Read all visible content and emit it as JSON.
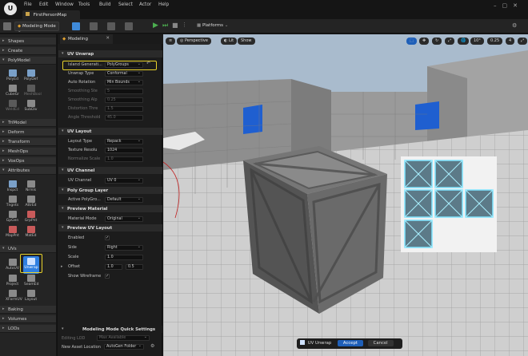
{
  "titlebar": {
    "map_name": "FirstPersonMap",
    "menus": [
      "File",
      "Edit",
      "Window",
      "Tools",
      "Build",
      "Select",
      "Actor",
      "Help"
    ]
  },
  "toolbar": {
    "mode_label": "Modeling Mode",
    "platforms_label": "Platforms"
  },
  "palette": {
    "categories": {
      "shapes": "Shapes",
      "create": "Create",
      "polymodel": "PolyModel",
      "trimodel": "TriModel",
      "deform": "Deform",
      "transform": "Transform",
      "meshops": "MeshOps",
      "voxops": "VoxOps",
      "attributes": "Attributes",
      "uvs": "UVs",
      "baking": "Baking",
      "volumes": "Volumes",
      "lods": "LODs"
    },
    "polymodel_tools": [
      "PolyEd",
      "PolyDef",
      "CubeGr",
      "MeshBool",
      "WeldEd",
      "SubDiv"
    ],
    "attribute_tools": [
      "Inspct",
      "Nrmls",
      "Tngnts",
      "AttrEd",
      "GpGen",
      "GrpPnt",
      "MapPnt",
      "MatEd"
    ],
    "uv_tools": [
      "AutoUV",
      "Unwrap",
      "Project",
      "SeamEd",
      "XFormUV",
      "Layout"
    ]
  },
  "panel": {
    "tab_label": "Modeling",
    "uv_unwrap": {
      "title": "UV Unwrap",
      "island_gen_label": "Island Generati...",
      "island_gen_value": "PolyGroups",
      "unwrap_type_label": "Unwrap Type",
      "unwrap_type_value": "Conformal",
      "auto_rotation_label": "Auto Rotation",
      "auto_rotation_value": "Min Bounds",
      "smoothing_label": "Smoothing Ste",
      "smoothing_value": "5",
      "smoothing_alpha_label": "Smoothing Alp",
      "smoothing_alpha_value": "0.25",
      "distortion_label": "Distortion Thre",
      "distortion_value": "1.5",
      "angle_label": "Angle Threshold",
      "angle_value": "45.0"
    },
    "uv_layout": {
      "title": "UV Layout",
      "layout_type_label": "Layout Type",
      "layout_type_value": "Repack",
      "texture_res_label": "Texture Resolu",
      "texture_res_value": "1024",
      "uniform_scale_label": "Normalize Scale",
      "uniform_scale_value": "1.0"
    },
    "uv_channel": {
      "title": "UV Channel",
      "label": "UV Channel",
      "value": "UV 0"
    },
    "poly_group_layer": {
      "title": "Poly Group Layer",
      "label": "Active PolyGro...",
      "value": "Default"
    },
    "preview_material": {
      "title": "Preview Material",
      "label": "Material Mode",
      "value": "Original"
    },
    "preview_uv_layout": {
      "title": "Preview UV Layout",
      "enabled_label": "Enabled",
      "side_label": "Side",
      "side_value": "Right",
      "scale_label": "Scale",
      "scale_value": "1.0",
      "offset_label": "Offset",
      "offset_x": "1.0",
      "offset_y": "0.5",
      "wireframe_label": "Show Wireframe"
    },
    "settings": {
      "title": "Modeling Mode Quick Settings",
      "editing_lod_label": "Editing LOD",
      "editing_lod_value": "Max Available",
      "asset_location_label": "New Asset Location",
      "asset_location_value": "AutoGen Folder"
    }
  },
  "viewport": {
    "perspective_label": "Perspective",
    "lit_label": "Lit",
    "show_label": "Show",
    "angle_value": "10°",
    "speed_value": "0.25",
    "cam_value": "4"
  },
  "accept_bar": {
    "tool_label": "UV Unwrap",
    "accept_label": "Accept",
    "cancel_label": "Cancel"
  },
  "colors": {
    "highlight": "#e8d22a",
    "active_tool": "#2f7fe0",
    "accept_button": "#1f5fb8"
  }
}
